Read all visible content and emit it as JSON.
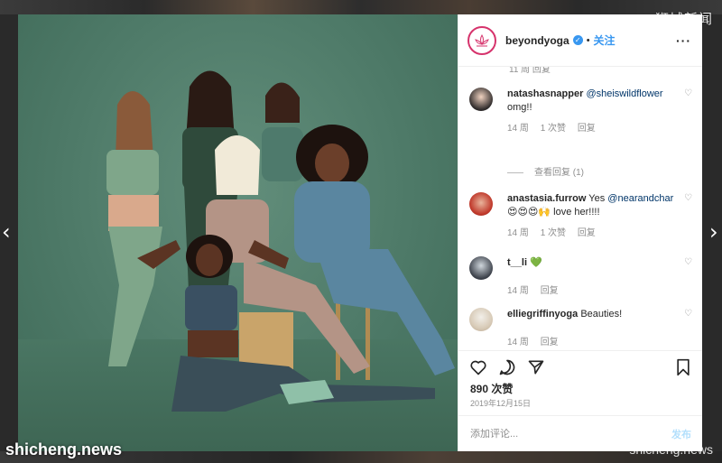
{
  "watermarks": {
    "top_right": "狮城新闻",
    "bottom_left": "shicheng.news",
    "bottom_right": "shicheng.news"
  },
  "nav": {
    "prev_icon": "chevron-left-icon",
    "next_icon": "chevron-right-icon"
  },
  "colors": {
    "link_blue": "#3897f0",
    "mention_blue": "#003569",
    "muted_gray": "#8e8e8e",
    "photo_green": "#4e7a68"
  },
  "post": {
    "account": "beyondyoga",
    "verified": true,
    "separator": "•",
    "follow_label": "关注",
    "more_label": "···",
    "cut_row": "11 周   回复",
    "likes": "890 次赞",
    "date": "2019年12月15日",
    "comment_placeholder": "添加评论...",
    "post_label": "发布"
  },
  "comments": [
    {
      "user": "natashasnapper",
      "mention": "@sheiswildflower",
      "text": "omg!!",
      "meta": [
        "14 周",
        "1 次赞",
        "回复"
      ],
      "view_replies": "查看回复 (1)"
    },
    {
      "user": "anastasia.furrow",
      "text_before": "Yes ",
      "mention": "@nearandchar",
      "text": "😍😍😍🙌 love her!!!!",
      "meta": [
        "14 周",
        "1 次赞",
        "回复"
      ]
    },
    {
      "user": "t__li",
      "text": "💚",
      "meta": [
        "14 周",
        "回复"
      ]
    },
    {
      "user": "elliegriffinyoga",
      "text": "Beauties!",
      "meta": [
        "14 周",
        "回复"
      ]
    }
  ]
}
